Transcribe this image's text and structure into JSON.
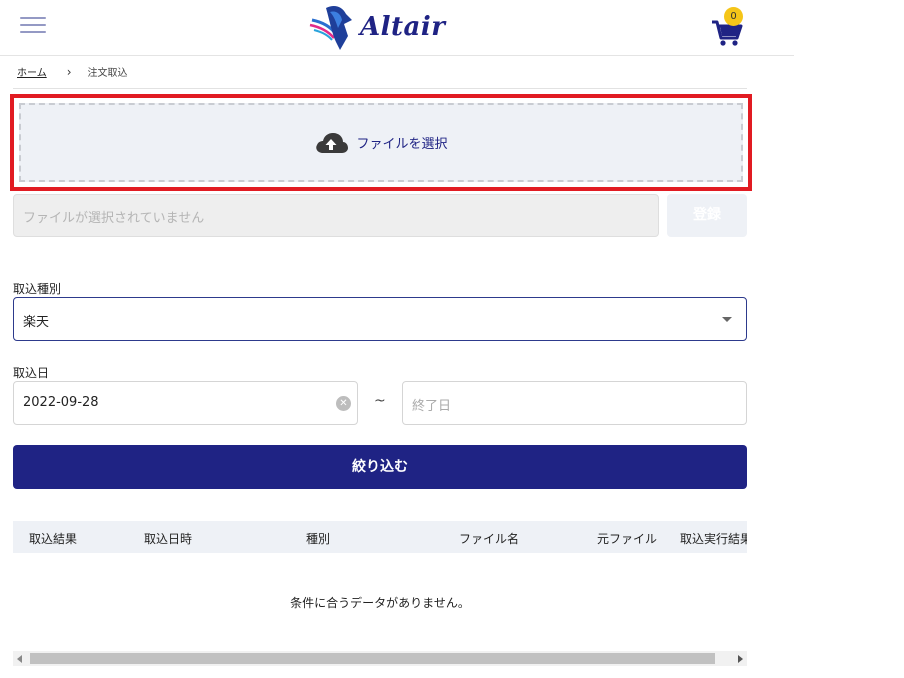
{
  "header": {
    "brand": "Altair",
    "cart_count": "0"
  },
  "breadcrumb": {
    "home": "ホーム",
    "current": "注文取込"
  },
  "upload": {
    "select_label": "ファイルを選択",
    "file_placeholder": "ファイルが選択されていません",
    "register_label": "登録"
  },
  "form": {
    "type_label": "取込種別",
    "type_value": "楽天",
    "date_label": "取込日",
    "start_date": "2022-09-28",
    "range_sep": "~",
    "end_placeholder": "終了日",
    "filter_label": "絞り込む"
  },
  "table": {
    "headers": [
      "取込結果",
      "取込日時",
      "種別",
      "ファイル名",
      "元ファイル",
      "取込実行結果"
    ],
    "empty_message": "条件に合うデータがありません。"
  },
  "colors": {
    "accent": "#1f2384",
    "highlight_border": "#e11b22",
    "badge": "#f5c518"
  }
}
